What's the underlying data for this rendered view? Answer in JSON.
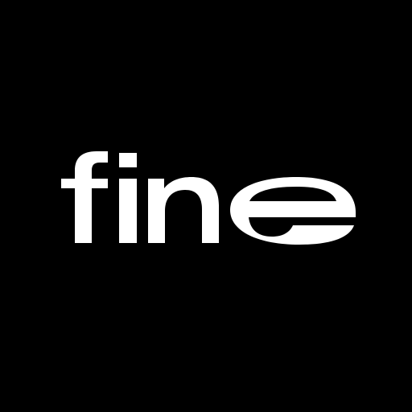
{
  "logo": {
    "text": "fine",
    "text_color": "#ffffff",
    "background_color": "#000000"
  }
}
